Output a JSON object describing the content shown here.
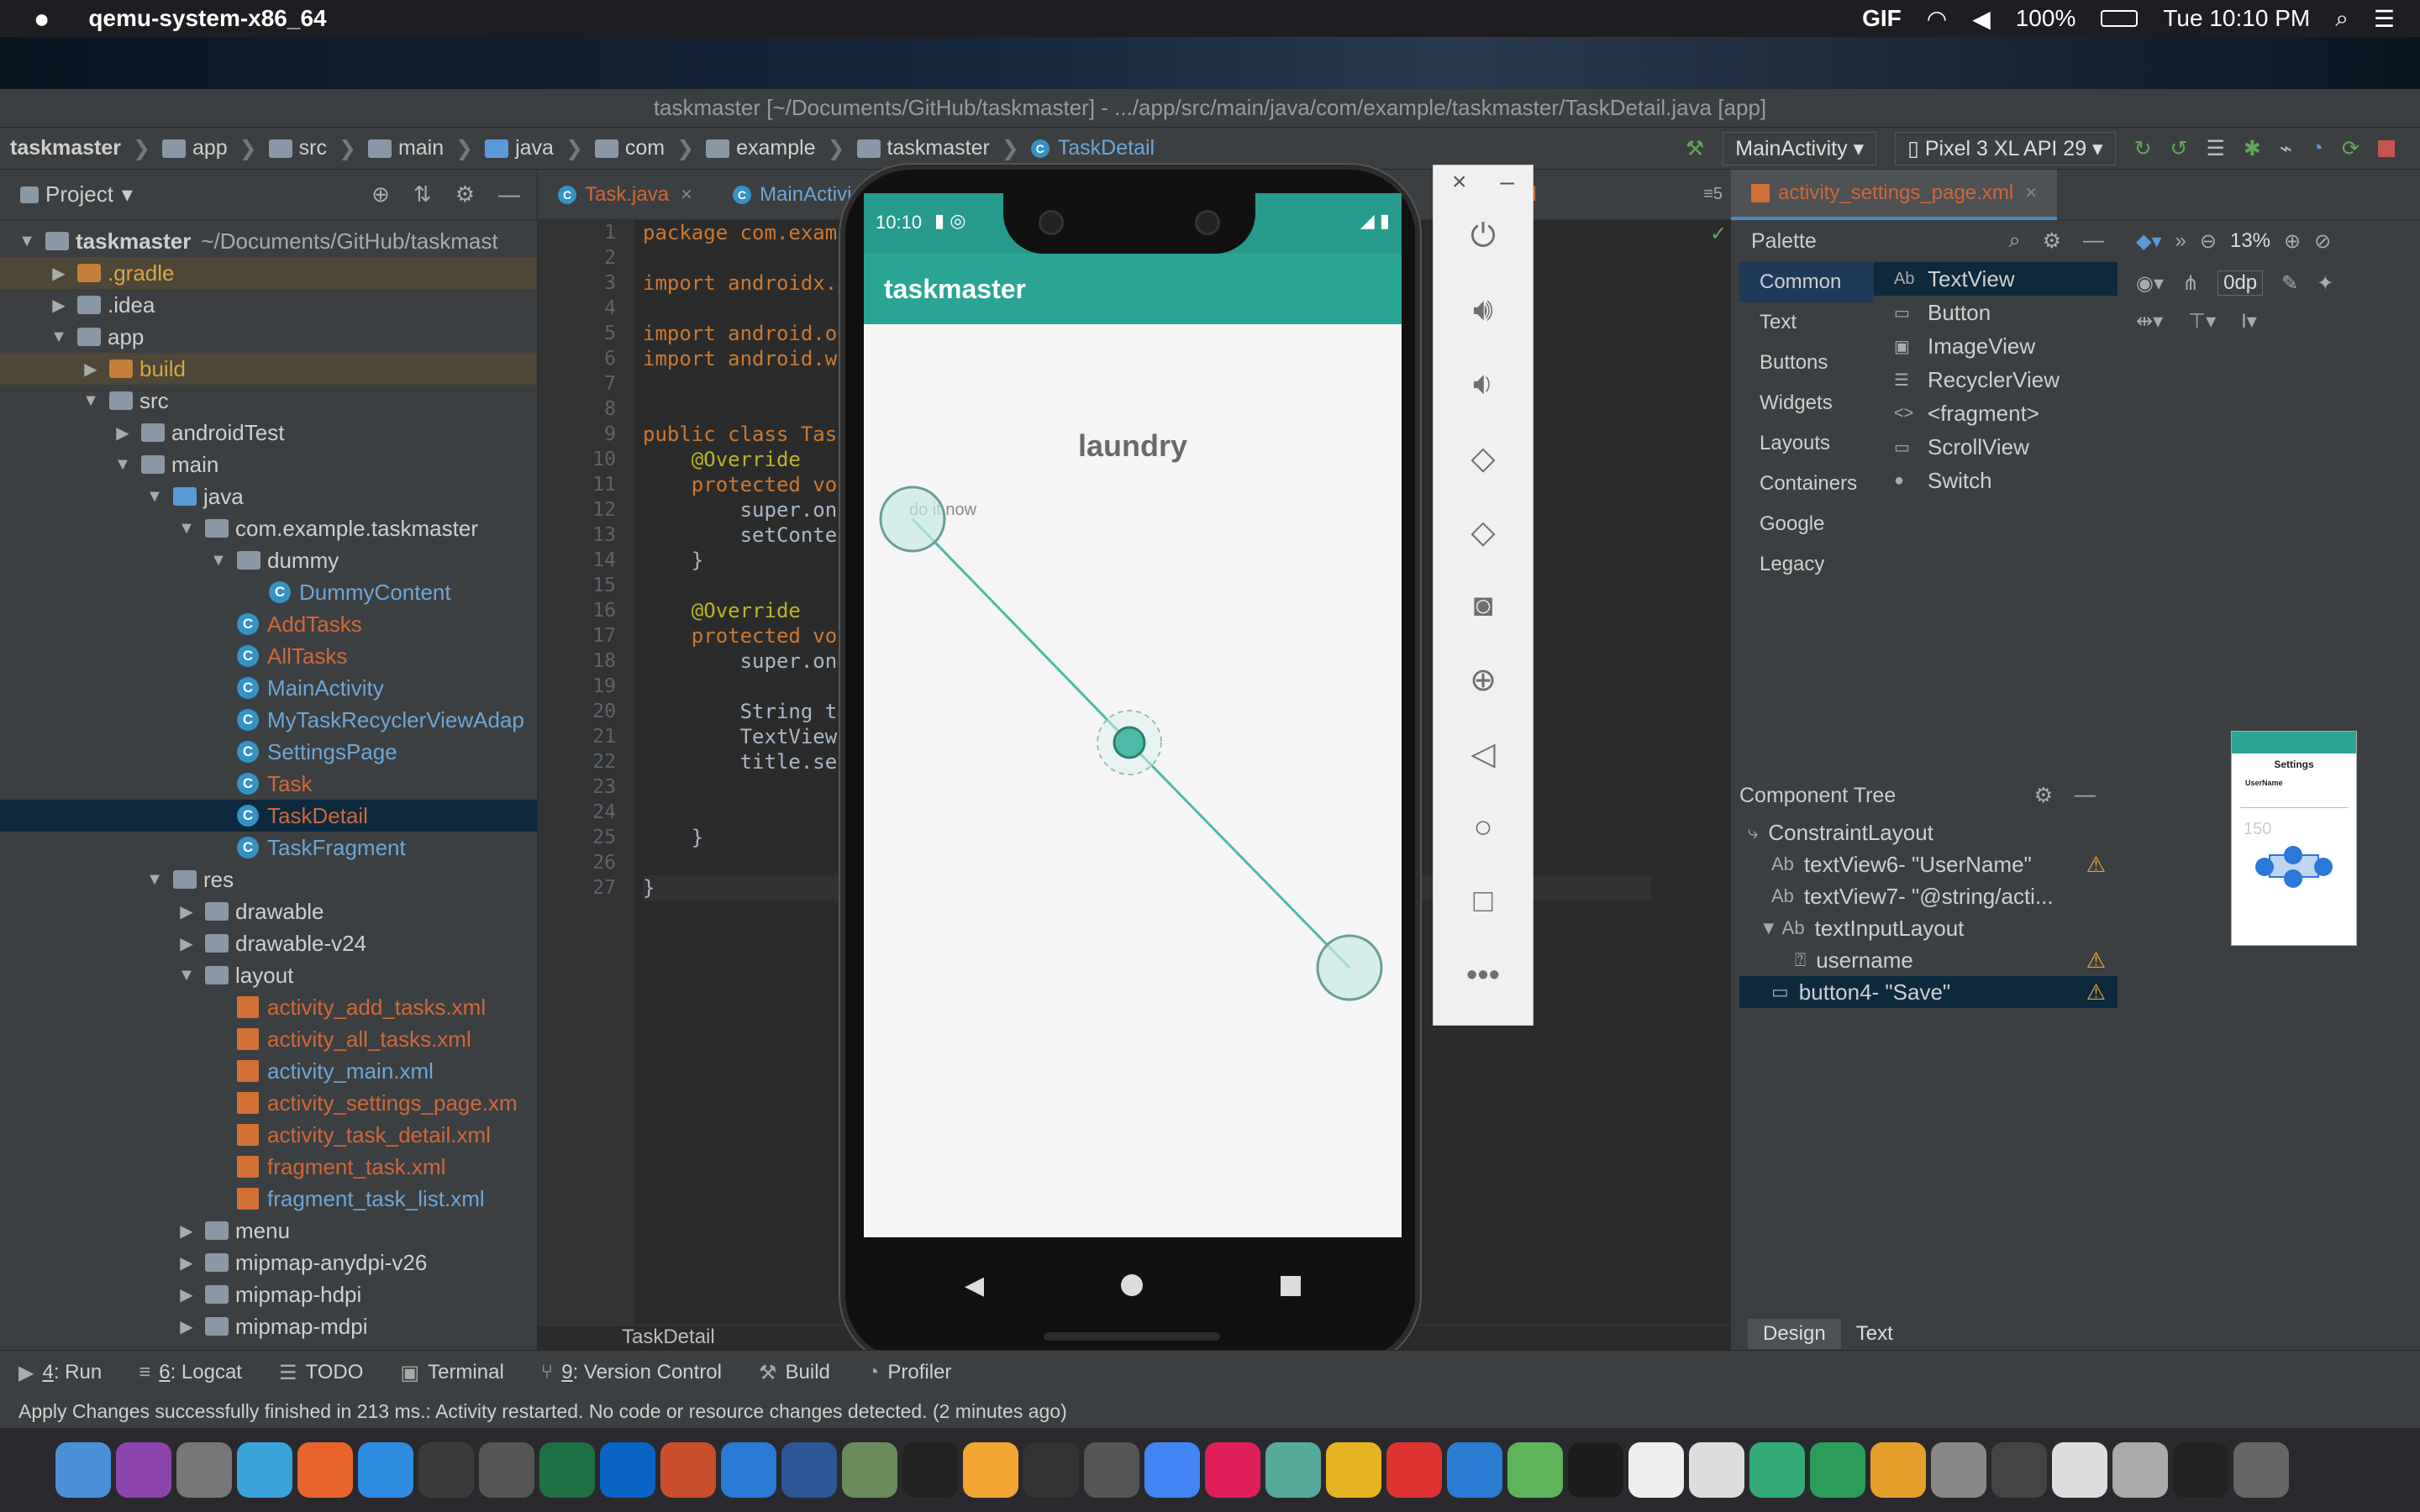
{
  "menubar": {
    "app_name": "qemu-system-x86_64",
    "battery": "100%",
    "datetime": "Tue 10:10 PM",
    "gif": "GIF"
  },
  "window_title": "taskmaster [~/Documents/GitHub/taskmaster] - .../app/src/main/java/com/example/taskmaster/TaskDetail.java [app]",
  "breadcrumb": [
    "taskmaster",
    "app",
    "src",
    "main",
    "java",
    "com",
    "example",
    "taskmaster",
    "TaskDetail"
  ],
  "toolbar": {
    "run_config": "MainActivity",
    "device": "Pixel 3 XL API 29"
  },
  "project_panel": {
    "title": "Project",
    "tree": [
      {
        "label": "taskmaster",
        "extra": "~/Documents/GitHub/taskmast",
        "depth": 0,
        "arrow": "▼",
        "type": "module",
        "color": ""
      },
      {
        "label": ".gradle",
        "depth": 1,
        "arrow": "▶",
        "type": "folder-or",
        "color": "yel",
        "hl": true
      },
      {
        "label": ".idea",
        "depth": 1,
        "arrow": "▶",
        "type": "folder",
        "color": ""
      },
      {
        "label": "app",
        "depth": 1,
        "arrow": "▼",
        "type": "folder",
        "color": ""
      },
      {
        "label": "build",
        "depth": 2,
        "arrow": "▶",
        "type": "folder-or",
        "color": "yel",
        "hl": true
      },
      {
        "label": "src",
        "depth": 2,
        "arrow": "▼",
        "type": "folder",
        "color": ""
      },
      {
        "label": "androidTest",
        "depth": 3,
        "arrow": "▶",
        "type": "folder",
        "color": ""
      },
      {
        "label": "main",
        "depth": 3,
        "arrow": "▼",
        "type": "folder",
        "color": ""
      },
      {
        "label": "java",
        "depth": 4,
        "arrow": "▼",
        "type": "folder-bl",
        "color": ""
      },
      {
        "label": "com.example.taskmaster",
        "depth": 5,
        "arrow": "▼",
        "type": "folder",
        "color": ""
      },
      {
        "label": "dummy",
        "depth": 6,
        "arrow": "▼",
        "type": "folder",
        "color": ""
      },
      {
        "label": "DummyContent",
        "depth": 7,
        "arrow": "",
        "type": "class",
        "color": "blue"
      },
      {
        "label": "AddTasks",
        "depth": 6,
        "arrow": "",
        "type": "class",
        "color": "red"
      },
      {
        "label": "AllTasks",
        "depth": 6,
        "arrow": "",
        "type": "class",
        "color": "red"
      },
      {
        "label": "MainActivity",
        "depth": 6,
        "arrow": "",
        "type": "class",
        "color": "blue"
      },
      {
        "label": "MyTaskRecyclerViewAdap",
        "depth": 6,
        "arrow": "",
        "type": "class",
        "color": "blue"
      },
      {
        "label": "SettingsPage",
        "depth": 6,
        "arrow": "",
        "type": "class",
        "color": "blue"
      },
      {
        "label": "Task",
        "depth": 6,
        "arrow": "",
        "type": "class",
        "color": "red"
      },
      {
        "label": "TaskDetail",
        "depth": 6,
        "arrow": "",
        "type": "class",
        "color": "red",
        "sel": true
      },
      {
        "label": "TaskFragment",
        "depth": 6,
        "arrow": "",
        "type": "class",
        "color": "blue"
      },
      {
        "label": "res",
        "depth": 4,
        "arrow": "▼",
        "type": "folder",
        "color": ""
      },
      {
        "label": "drawable",
        "depth": 5,
        "arrow": "▶",
        "type": "folder",
        "color": ""
      },
      {
        "label": "drawable-v24",
        "depth": 5,
        "arrow": "▶",
        "type": "folder",
        "color": ""
      },
      {
        "label": "layout",
        "depth": 5,
        "arrow": "▼",
        "type": "folder",
        "color": ""
      },
      {
        "label": "activity_add_tasks.xml",
        "depth": 6,
        "arrow": "",
        "type": "xml",
        "color": "red"
      },
      {
        "label": "activity_all_tasks.xml",
        "depth": 6,
        "arrow": "",
        "type": "xml",
        "color": "red"
      },
      {
        "label": "activity_main.xml",
        "depth": 6,
        "arrow": "",
        "type": "xml",
        "color": "blue"
      },
      {
        "label": "activity_settings_page.xm",
        "depth": 6,
        "arrow": "",
        "type": "xml",
        "color": "red"
      },
      {
        "label": "activity_task_detail.xml",
        "depth": 6,
        "arrow": "",
        "type": "xml",
        "color": "red"
      },
      {
        "label": "fragment_task.xml",
        "depth": 6,
        "arrow": "",
        "type": "xml",
        "color": "red"
      },
      {
        "label": "fragment_task_list.xml",
        "depth": 6,
        "arrow": "",
        "type": "xml",
        "color": "blue"
      },
      {
        "label": "menu",
        "depth": 5,
        "arrow": "▶",
        "type": "folder",
        "color": ""
      },
      {
        "label": "mipmap-anydpi-v26",
        "depth": 5,
        "arrow": "▶",
        "type": "folder",
        "color": ""
      },
      {
        "label": "mipmap-hdpi",
        "depth": 5,
        "arrow": "▶",
        "type": "folder",
        "color": ""
      },
      {
        "label": "mipmap-mdpi",
        "depth": 5,
        "arrow": "▶",
        "type": "folder",
        "color": ""
      }
    ]
  },
  "editor": {
    "tabs": [
      "Task.java",
      "MainActivi"
    ],
    "right_tab_frag": "xml",
    "tab_counter": "5",
    "lines": [
      "package com.examp",
      "",
      "import androidx.a",
      "",
      "import android.os",
      "import android.wi",
      "",
      "",
      "public class Task",
      "    @Override",
      "    protected voi",
      "        super.onC",
      "        setConter",
      "    }",
      "",
      "    @Override",
      "    protected voi",
      "        super.onR",
      "",
      "        String ta",
      "        TextView",
      "        title.set",
      "",
      "",
      "    }",
      "",
      "}"
    ],
    "footer": "TaskDetail"
  },
  "emulator": {
    "time": "10:10",
    "app_title": "taskmaster",
    "task_title": "laundry",
    "task_body": "do it now"
  },
  "right_panel": {
    "tab": "activity_settings_page.xml",
    "zoom": "13%",
    "margin": "0dp",
    "palette_title": "Palette",
    "categories": [
      "Common",
      "Text",
      "Buttons",
      "Widgets",
      "Layouts",
      "Containers",
      "Google",
      "Legacy"
    ],
    "items": [
      {
        "icon": "Ab",
        "label": "TextView"
      },
      {
        "icon": "▭",
        "label": "Button"
      },
      {
        "icon": "▣",
        "label": "ImageView"
      },
      {
        "icon": "☰",
        "label": "RecyclerView"
      },
      {
        "icon": "<>",
        "label": "<fragment>"
      },
      {
        "icon": "▭",
        "label": "ScrollView"
      },
      {
        "icon": "●",
        "label": "Switch"
      }
    ],
    "tree_title": "Component Tree",
    "tree": [
      {
        "icon": "⤷",
        "label": "ConstraintLayout",
        "warn": false,
        "depth": 0
      },
      {
        "icon": "Ab",
        "label": "textView6- \"UserName\"",
        "warn": true,
        "depth": 1
      },
      {
        "icon": "Ab",
        "label": "textView7- \"@string/acti...",
        "warn": false,
        "depth": 1
      },
      {
        "icon": "▼ Ab",
        "label": "textInputLayout",
        "warn": false,
        "depth": 0.5
      },
      {
        "icon": "⍰",
        "label": "username",
        "warn": true,
        "depth": 2
      },
      {
        "icon": "▭",
        "label": "button4- \"Save\"",
        "warn": true,
        "depth": 1,
        "sel": true
      }
    ],
    "mini_title": "Settings",
    "mini_label": "UserName",
    "mini_value": "150",
    "design_tab": "Design",
    "text_tab": "Text"
  },
  "bottom_tools": [
    {
      "key": "4",
      "label": ": Run"
    },
    {
      "key": "6",
      "label": ": Logcat"
    },
    {
      "key": "",
      "label": "TODO"
    },
    {
      "key": "",
      "label": "Terminal"
    },
    {
      "key": "9",
      "label": ": Version Control"
    },
    {
      "key": "",
      "label": "Build"
    },
    {
      "key": "",
      "label": "Profiler"
    }
  ],
  "status": "Apply Changes successfully finished in 213 ms.: Activity restarted. No code or resource changes detected. (2 minutes ago)",
  "colors": {
    "accent": "#2aa595",
    "ide_bg": "#2b2b2b",
    "panel": "#3c3f41",
    "selection": "#0d293e"
  }
}
